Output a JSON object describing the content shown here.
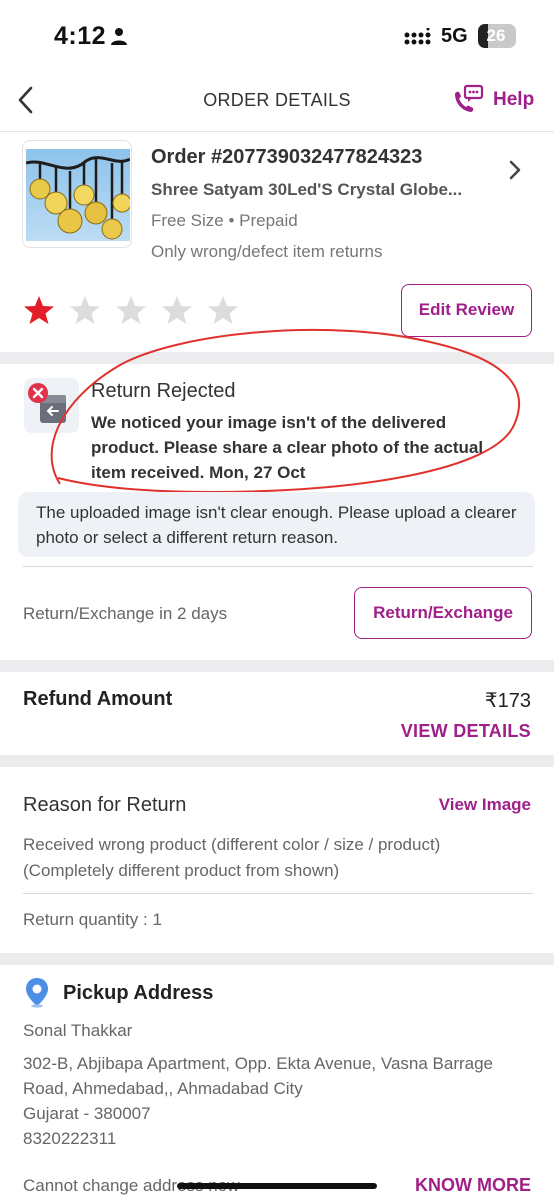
{
  "status_bar": {
    "time": "4:12",
    "network": "5G",
    "battery": "26",
    "battery_level": 0.26
  },
  "header": {
    "title": "ORDER DETAILS",
    "help_label": "Help"
  },
  "order": {
    "order_id": "Order #207739032477824323",
    "product_name": "Shree Satyam 30Led'S Crystal Globe...",
    "meta": "Free Size • Prepaid",
    "return_policy": "Only wrong/defect item returns",
    "rating": 1,
    "rating_max": 5,
    "edit_review_label": "Edit Review"
  },
  "return_status": {
    "title": "Return Rejected",
    "message": "We noticed your image isn't of the delivered product. Please share a clear photo of the actual item received. Mon, 27 Oct",
    "info": "The uploaded image isn't clear enough. Please upload a clearer photo or select a different return reason.",
    "window_text": "Return/Exchange in 2 days",
    "return_exchange_label": "Return/Exchange"
  },
  "refund": {
    "label": "Refund Amount",
    "amount": "₹173",
    "view_details_label": "VIEW DETAILS"
  },
  "reason": {
    "heading": "Reason for Return",
    "view_image_label": "View Image",
    "text": "Received wrong product (different color / size / product) (Completely different product from shown)",
    "quantity": "Return quantity : 1"
  },
  "pickup": {
    "heading": "Pickup Address",
    "name": "Sonal Thakkar",
    "address_line1": "302-B, Abjibapa Apartment, Opp. Ekta Avenue, Vasna Barrage Road, Ahmedabad,, Ahmadabad City",
    "address_line2": "Gujarat - 380007",
    "phone": "8320222311",
    "change_note": "Cannot change address now",
    "know_more_label": "KNOW MORE"
  },
  "colors": {
    "accent": "#9f2089",
    "star_filled": "#e41e26",
    "star_empty": "#dcdcdc",
    "error": "#e0334a",
    "annotation": "#e0322c"
  }
}
